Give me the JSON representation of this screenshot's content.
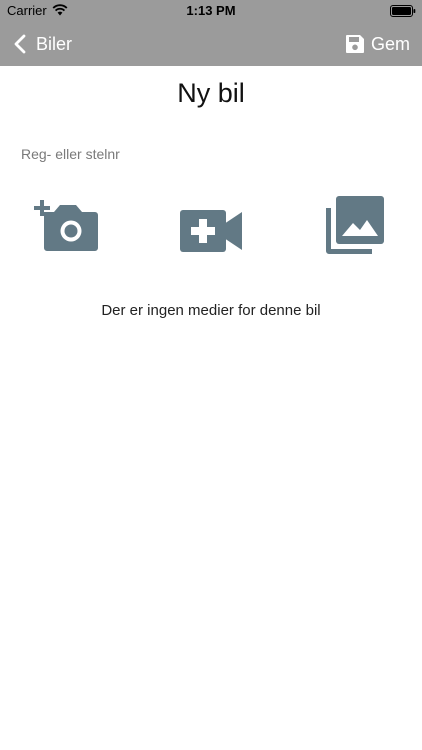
{
  "status_bar": {
    "carrier": "Carrier",
    "time": "1:13 PM"
  },
  "navbar": {
    "back_label": "Biler",
    "save_label": "Gem",
    "background_color": "#9b9b9b"
  },
  "page": {
    "title": "Ny bil"
  },
  "registration": {
    "placeholder": "Reg- eller stelnr",
    "value": ""
  },
  "media_buttons": [
    {
      "icon": "add-photo-icon"
    },
    {
      "icon": "add-video-icon"
    },
    {
      "icon": "photo-library-icon"
    }
  ],
  "media": {
    "empty_message": "Der er ingen medier for denne bil"
  },
  "colors": {
    "icon": "#627985",
    "nav_text": "#ffffff"
  }
}
